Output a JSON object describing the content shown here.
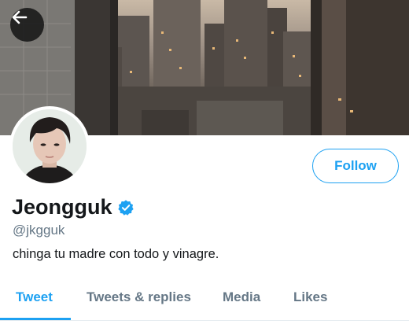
{
  "header": {
    "back_icon": "arrow-left-icon"
  },
  "profile": {
    "display_name": "Jeongguk",
    "verified_icon": "verified-badge-icon",
    "handle": "@jkgguk",
    "bio": "chinga tu madre con todo y vinagre.",
    "follow_label": "Follow"
  },
  "tabs": [
    {
      "label": "Tweet",
      "active": true
    },
    {
      "label": "Tweets & replies",
      "active": false
    },
    {
      "label": "Media",
      "active": false
    },
    {
      "label": "Likes",
      "active": false
    }
  ],
  "colors": {
    "accent": "#1da1f2",
    "text": "#14171a",
    "muted": "#657786"
  }
}
